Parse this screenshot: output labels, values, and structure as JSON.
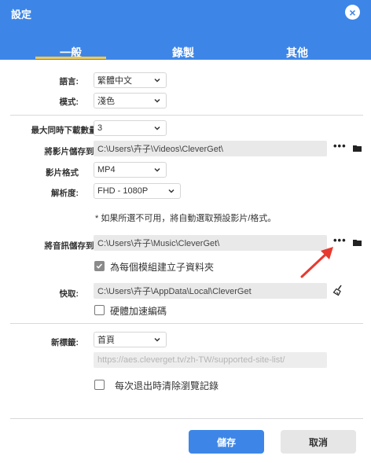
{
  "window": {
    "title": "設定"
  },
  "tabs": [
    {
      "label": "一般",
      "active": true
    },
    {
      "label": "錄製",
      "active": false
    },
    {
      "label": "其他",
      "active": false
    }
  ],
  "general": {
    "language": {
      "label": "語言:",
      "value": "繁體中文"
    },
    "mode": {
      "label": "模式:",
      "value": "淺色"
    },
    "max_downloads": {
      "label": "最大同時下載數量:",
      "value": "3"
    },
    "video_save": {
      "label": "將影片儲存到:",
      "path": "C:\\Users\\卉子\\Videos\\CleverGet\\"
    },
    "video_format": {
      "label": "影片格式",
      "value": "MP4"
    },
    "resolution": {
      "label": "解析度:",
      "value": "FHD - 1080P"
    },
    "format_note": "* 如果所選不可用，將自動選取預設影片/格式。",
    "audio_save": {
      "label": "將音訊儲存到:",
      "path": "C:\\Users\\卉子\\Music\\CleverGet\\"
    },
    "subfolder_checkbox": {
      "label": "為每個模組建立子資料夾",
      "checked": true
    },
    "cache": {
      "label": "快取:",
      "path": "C:\\Users\\卉子\\AppData\\Local\\CleverGet"
    },
    "hw_accel_checkbox": {
      "label": "硬體加速編碼",
      "checked": false
    },
    "new_tab": {
      "label": "新標籤:",
      "value": "首頁",
      "url_placeholder": "https://aes.cleverget.tv/zh-TW/supported-site-list/"
    },
    "clear_history_checkbox": {
      "label": "每次退出時清除瀏覽記錄",
      "checked": false
    }
  },
  "buttons": {
    "save": "儲存",
    "cancel": "取消"
  },
  "colors": {
    "accent": "#3d86e8",
    "tab_underline": "#f2c94c",
    "annotation_arrow": "#e8392f"
  },
  "icons": {
    "more": "more-dots-icon",
    "folder": "folder-icon",
    "broom": "broom-icon",
    "close": "close-icon"
  }
}
